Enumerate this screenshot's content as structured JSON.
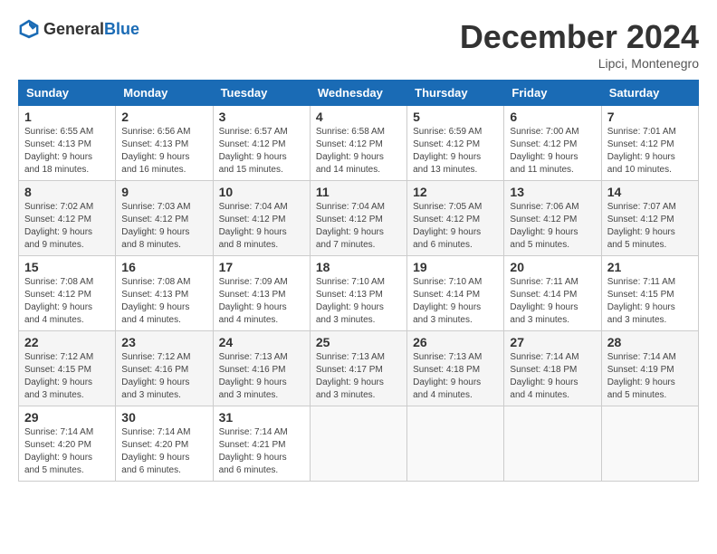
{
  "header": {
    "logo_general": "General",
    "logo_blue": "Blue",
    "month_title": "December 2024",
    "location": "Lipci, Montenegro"
  },
  "days_of_week": [
    "Sunday",
    "Monday",
    "Tuesday",
    "Wednesday",
    "Thursday",
    "Friday",
    "Saturday"
  ],
  "weeks": [
    [
      {
        "day": "1",
        "sunrise": "Sunrise: 6:55 AM",
        "sunset": "Sunset: 4:13 PM",
        "daylight": "Daylight: 9 hours and 18 minutes."
      },
      {
        "day": "2",
        "sunrise": "Sunrise: 6:56 AM",
        "sunset": "Sunset: 4:13 PM",
        "daylight": "Daylight: 9 hours and 16 minutes."
      },
      {
        "day": "3",
        "sunrise": "Sunrise: 6:57 AM",
        "sunset": "Sunset: 4:12 PM",
        "daylight": "Daylight: 9 hours and 15 minutes."
      },
      {
        "day": "4",
        "sunrise": "Sunrise: 6:58 AM",
        "sunset": "Sunset: 4:12 PM",
        "daylight": "Daylight: 9 hours and 14 minutes."
      },
      {
        "day": "5",
        "sunrise": "Sunrise: 6:59 AM",
        "sunset": "Sunset: 4:12 PM",
        "daylight": "Daylight: 9 hours and 13 minutes."
      },
      {
        "day": "6",
        "sunrise": "Sunrise: 7:00 AM",
        "sunset": "Sunset: 4:12 PM",
        "daylight": "Daylight: 9 hours and 11 minutes."
      },
      {
        "day": "7",
        "sunrise": "Sunrise: 7:01 AM",
        "sunset": "Sunset: 4:12 PM",
        "daylight": "Daylight: 9 hours and 10 minutes."
      }
    ],
    [
      {
        "day": "8",
        "sunrise": "Sunrise: 7:02 AM",
        "sunset": "Sunset: 4:12 PM",
        "daylight": "Daylight: 9 hours and 9 minutes."
      },
      {
        "day": "9",
        "sunrise": "Sunrise: 7:03 AM",
        "sunset": "Sunset: 4:12 PM",
        "daylight": "Daylight: 9 hours and 8 minutes."
      },
      {
        "day": "10",
        "sunrise": "Sunrise: 7:04 AM",
        "sunset": "Sunset: 4:12 PM",
        "daylight": "Daylight: 9 hours and 8 minutes."
      },
      {
        "day": "11",
        "sunrise": "Sunrise: 7:04 AM",
        "sunset": "Sunset: 4:12 PM",
        "daylight": "Daylight: 9 hours and 7 minutes."
      },
      {
        "day": "12",
        "sunrise": "Sunrise: 7:05 AM",
        "sunset": "Sunset: 4:12 PM",
        "daylight": "Daylight: 9 hours and 6 minutes."
      },
      {
        "day": "13",
        "sunrise": "Sunrise: 7:06 AM",
        "sunset": "Sunset: 4:12 PM",
        "daylight": "Daylight: 9 hours and 5 minutes."
      },
      {
        "day": "14",
        "sunrise": "Sunrise: 7:07 AM",
        "sunset": "Sunset: 4:12 PM",
        "daylight": "Daylight: 9 hours and 5 minutes."
      }
    ],
    [
      {
        "day": "15",
        "sunrise": "Sunrise: 7:08 AM",
        "sunset": "Sunset: 4:12 PM",
        "daylight": "Daylight: 9 hours and 4 minutes."
      },
      {
        "day": "16",
        "sunrise": "Sunrise: 7:08 AM",
        "sunset": "Sunset: 4:13 PM",
        "daylight": "Daylight: 9 hours and 4 minutes."
      },
      {
        "day": "17",
        "sunrise": "Sunrise: 7:09 AM",
        "sunset": "Sunset: 4:13 PM",
        "daylight": "Daylight: 9 hours and 4 minutes."
      },
      {
        "day": "18",
        "sunrise": "Sunrise: 7:10 AM",
        "sunset": "Sunset: 4:13 PM",
        "daylight": "Daylight: 9 hours and 3 minutes."
      },
      {
        "day": "19",
        "sunrise": "Sunrise: 7:10 AM",
        "sunset": "Sunset: 4:14 PM",
        "daylight": "Daylight: 9 hours and 3 minutes."
      },
      {
        "day": "20",
        "sunrise": "Sunrise: 7:11 AM",
        "sunset": "Sunset: 4:14 PM",
        "daylight": "Daylight: 9 hours and 3 minutes."
      },
      {
        "day": "21",
        "sunrise": "Sunrise: 7:11 AM",
        "sunset": "Sunset: 4:15 PM",
        "daylight": "Daylight: 9 hours and 3 minutes."
      }
    ],
    [
      {
        "day": "22",
        "sunrise": "Sunrise: 7:12 AM",
        "sunset": "Sunset: 4:15 PM",
        "daylight": "Daylight: 9 hours and 3 minutes."
      },
      {
        "day": "23",
        "sunrise": "Sunrise: 7:12 AM",
        "sunset": "Sunset: 4:16 PM",
        "daylight": "Daylight: 9 hours and 3 minutes."
      },
      {
        "day": "24",
        "sunrise": "Sunrise: 7:13 AM",
        "sunset": "Sunset: 4:16 PM",
        "daylight": "Daylight: 9 hours and 3 minutes."
      },
      {
        "day": "25",
        "sunrise": "Sunrise: 7:13 AM",
        "sunset": "Sunset: 4:17 PM",
        "daylight": "Daylight: 9 hours and 3 minutes."
      },
      {
        "day": "26",
        "sunrise": "Sunrise: 7:13 AM",
        "sunset": "Sunset: 4:18 PM",
        "daylight": "Daylight: 9 hours and 4 minutes."
      },
      {
        "day": "27",
        "sunrise": "Sunrise: 7:14 AM",
        "sunset": "Sunset: 4:18 PM",
        "daylight": "Daylight: 9 hours and 4 minutes."
      },
      {
        "day": "28",
        "sunrise": "Sunrise: 7:14 AM",
        "sunset": "Sunset: 4:19 PM",
        "daylight": "Daylight: 9 hours and 5 minutes."
      }
    ],
    [
      {
        "day": "29",
        "sunrise": "Sunrise: 7:14 AM",
        "sunset": "Sunset: 4:20 PM",
        "daylight": "Daylight: 9 hours and 5 minutes."
      },
      {
        "day": "30",
        "sunrise": "Sunrise: 7:14 AM",
        "sunset": "Sunset: 4:20 PM",
        "daylight": "Daylight: 9 hours and 6 minutes."
      },
      {
        "day": "31",
        "sunrise": "Sunrise: 7:14 AM",
        "sunset": "Sunset: 4:21 PM",
        "daylight": "Daylight: 9 hours and 6 minutes."
      },
      null,
      null,
      null,
      null
    ]
  ]
}
